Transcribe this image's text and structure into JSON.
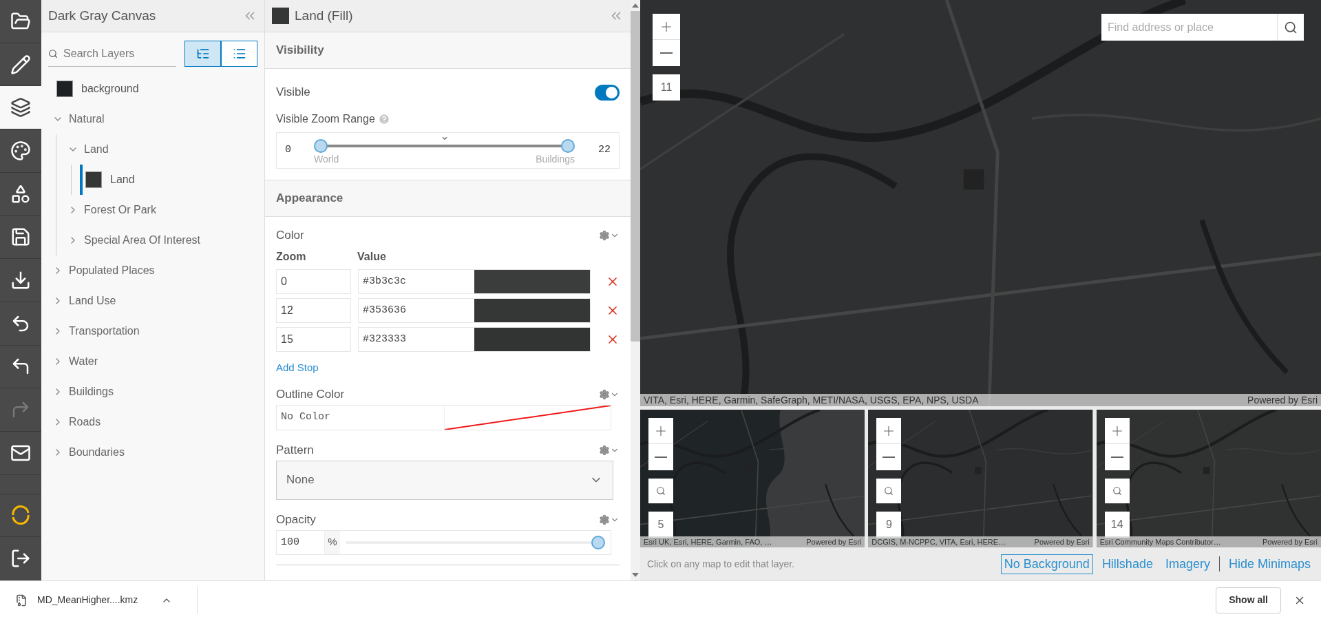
{
  "toolbar": [
    {
      "kind": "open",
      "selected": false,
      "disabled": false
    },
    {
      "kind": "edit",
      "selected": false,
      "disabled": false
    },
    {
      "kind": "layers",
      "selected": true,
      "disabled": false
    },
    {
      "kind": "style",
      "selected": false,
      "disabled": false
    },
    {
      "kind": "shapes",
      "selected": false,
      "disabled": false
    },
    {
      "kind": "save",
      "selected": false,
      "disabled": false
    },
    {
      "kind": "download",
      "selected": false,
      "disabled": false
    },
    {
      "kind": "import",
      "selected": false,
      "disabled": false
    },
    {
      "kind": "undo",
      "selected": false,
      "disabled": false
    },
    {
      "kind": "redo",
      "selected": false,
      "disabled": true
    },
    {
      "kind": "mail",
      "selected": false,
      "disabled": false
    },
    {
      "kind": "logo",
      "selected": false,
      "disabled": false
    },
    {
      "kind": "exit",
      "selected": false,
      "disabled": false
    }
  ],
  "layers_panel": {
    "title": "Dark Gray Canvas",
    "search": {
      "placeholder": "Search Layers"
    },
    "view_buttons": [
      {
        "kind": "tree",
        "selected": true
      },
      {
        "kind": "list",
        "selected": false
      }
    ],
    "tree": [
      {
        "kind": "layer",
        "name": "background",
        "color": "#1d2124",
        "selected": false
      },
      {
        "kind": "group",
        "name": "Natural",
        "expanded": true,
        "children": [
          {
            "kind": "group",
            "name": "Land",
            "expanded": true,
            "children": [
              {
                "kind": "layer",
                "name": "Land",
                "color": "#353636",
                "selected": true
              }
            ]
          },
          {
            "kind": "group",
            "name": "Forest Or Park",
            "expanded": false
          },
          {
            "kind": "group",
            "name": "Special Area Of Interest",
            "expanded": false
          }
        ]
      },
      {
        "kind": "group",
        "name": "Populated Places",
        "expanded": false
      },
      {
        "kind": "group",
        "name": "Land Use",
        "expanded": false
      },
      {
        "kind": "group",
        "name": "Transportation",
        "expanded": false
      },
      {
        "kind": "group",
        "name": "Water",
        "expanded": false
      },
      {
        "kind": "group",
        "name": "Buildings",
        "expanded": false
      },
      {
        "kind": "group",
        "name": "Roads",
        "expanded": false
      },
      {
        "kind": "group",
        "name": "Boundaries",
        "expanded": false
      }
    ]
  },
  "properties_panel": {
    "title": "Land (Fill)",
    "color": "#353636",
    "visibility": {
      "heading": "Visibility",
      "visible": {
        "label": "Visible",
        "on": true
      },
      "zoom_range": {
        "label": "Visible Zoom Range",
        "min": "0",
        "max": "22",
        "min_label": "World",
        "max_label": "Buildings",
        "current": {
          "level": 0.5
        },
        "thumbs": [
          {
            "level": 0
          },
          {
            "level": 1
          }
        ]
      }
    },
    "appearance": {
      "heading": "Appearance",
      "color": {
        "label": "Color",
        "columns": [
          "Zoom",
          "Value"
        ],
        "stops": [
          {
            "zoom": "0",
            "value": "#3b3c3c"
          },
          {
            "zoom": "12",
            "value": "#353636"
          },
          {
            "zoom": "15",
            "value": "#323333"
          }
        ],
        "add_link": "Add Stop"
      },
      "outline": {
        "label": "Outline Color",
        "value": "No Color"
      },
      "pattern": {
        "label": "Pattern",
        "value": "None"
      },
      "opacity": {
        "label": "Opacity",
        "value": "100",
        "unit": "%",
        "level": 1
      }
    }
  },
  "map": {
    "zoom_level": "11",
    "search": {
      "placeholder": "Find address or place"
    },
    "attribution": "VITA, Esri, HERE, Garmin, SafeGraph, METI/NASA, USGS, EPA, NPS, USDA",
    "powered_by": "Powered by Esri",
    "minimaps": [
      {
        "zoom_level": "5",
        "attribution": "Esri UK, Esri, HERE, Garmin, FAO, …",
        "powered_by": "Powered by Esri"
      },
      {
        "zoom_level": "9",
        "attribution": "DCGIS, M-NCPPC, VITA, Esri, HERE…",
        "powered_by": "Powered by Esri"
      },
      {
        "zoom_level": "14",
        "attribution": "Esri Community Maps Contributor…",
        "powered_by": "Powered by Esri"
      }
    ],
    "hint": "Click on any map to edit that layer.",
    "background_options": [
      {
        "label": "No Background",
        "selected": true
      },
      {
        "label": "Hillshade",
        "selected": false
      },
      {
        "label": "Imagery",
        "selected": false
      },
      {
        "label": "Hide Minimaps",
        "selected": false,
        "separated": true
      }
    ]
  },
  "download_bar": {
    "file": "MD_MeanHigher....kmz",
    "show_all": "Show all"
  }
}
